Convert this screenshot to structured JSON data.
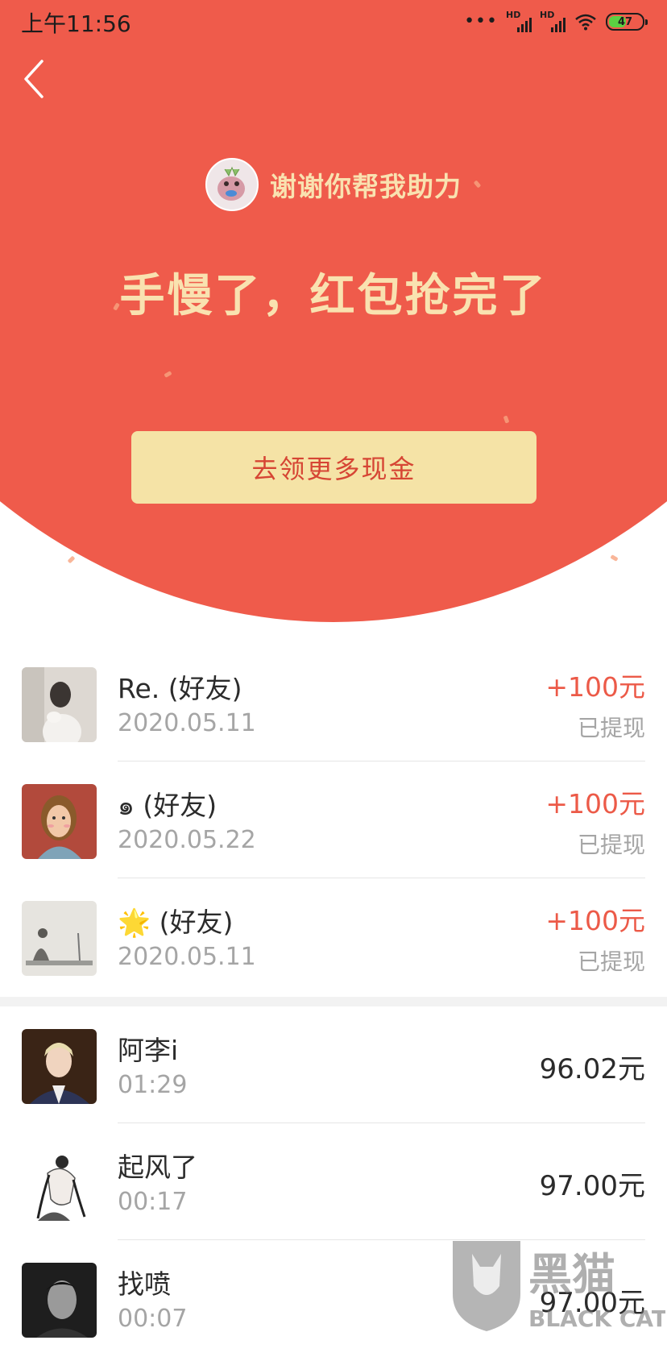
{
  "status_bar": {
    "time": "上午11:56",
    "signal_label": "HD",
    "battery_level": "47"
  },
  "header": {
    "helper_text": "谢谢你帮我助力",
    "headline": "手慢了，红包抢完了",
    "cta_label": "去领更多现金"
  },
  "friends": [
    {
      "name": "Re. (好友)",
      "date": "2020.05.11",
      "amount": "+100元",
      "status": "已提现"
    },
    {
      "name": "๑ (好友)",
      "date": "2020.05.22",
      "amount": "+100元",
      "status": "已提现"
    },
    {
      "name": "🌟 (好友)",
      "date": "2020.05.11",
      "amount": "+100元",
      "status": "已提现"
    }
  ],
  "records": [
    {
      "name": "阿李i",
      "time": "01:29",
      "amount": "96.02元"
    },
    {
      "name": "起风了",
      "time": "00:17",
      "amount": "97.00元"
    },
    {
      "name": "找喷",
      "time": "00:07",
      "amount": "97.00元"
    }
  ],
  "watermark": {
    "brand_cn": "黑猫",
    "brand_en": "BLACK CAT"
  },
  "colors": {
    "primary_red": "#ef5b4b",
    "gold_text": "#f9e2b0",
    "button_bg": "#f5e3a6",
    "amount_red": "#ec5a48"
  }
}
